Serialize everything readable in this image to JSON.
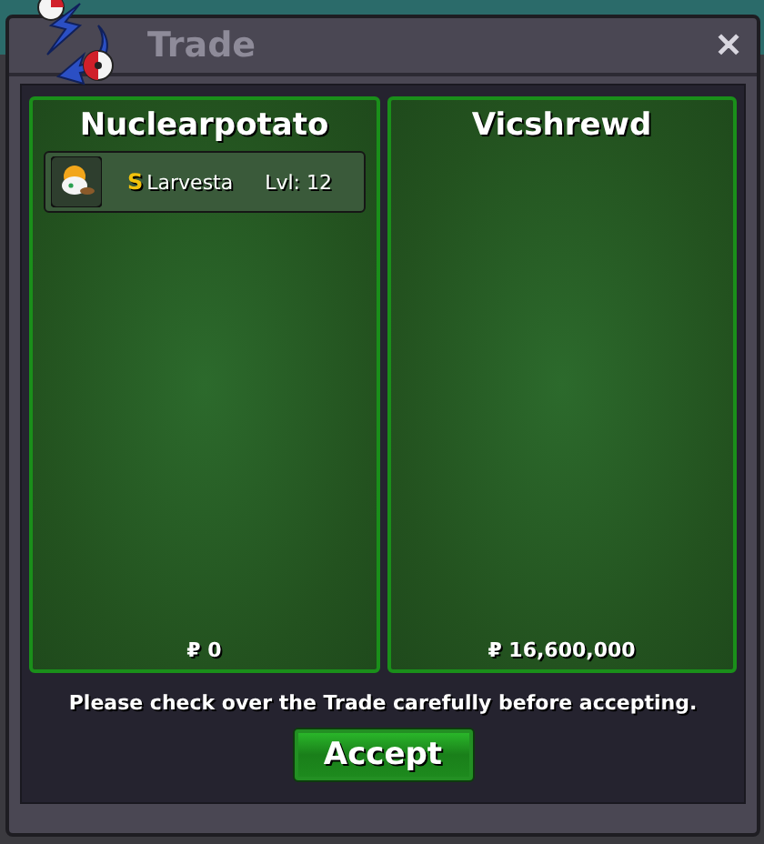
{
  "window": {
    "title": "Trade",
    "close": "✕"
  },
  "traders": [
    {
      "name": "Nuclearpotato",
      "money": "₽ 0",
      "items": [
        {
          "badge": "S",
          "name": "Larvesta",
          "level": "Lvl: 12"
        }
      ]
    },
    {
      "name": "Vicshrewd",
      "money": "₽ 16,600,000"
    }
  ],
  "notice": "Please check over the Trade carefully before accepting.",
  "accept_button": "Accept"
}
